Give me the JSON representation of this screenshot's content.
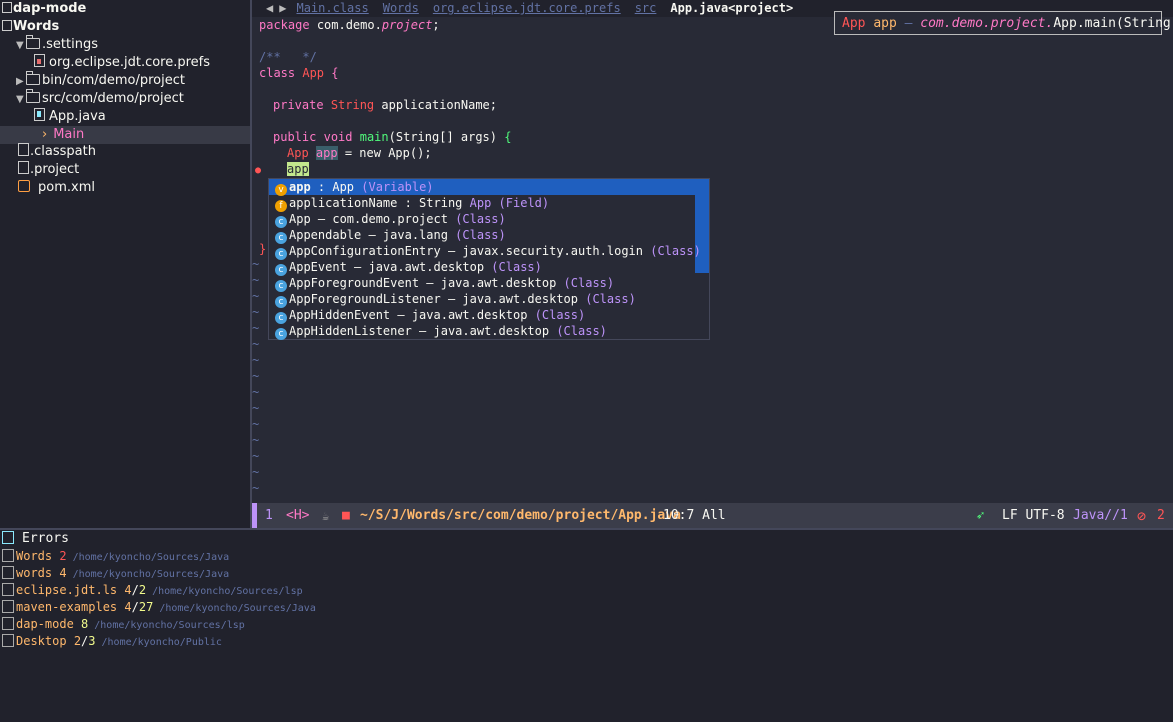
{
  "sidebar": {
    "workspace": "dap-mode",
    "project": "Words",
    "items": [
      {
        "label": ".settings"
      },
      {
        "label": "org.eclipse.jdt.core.prefs"
      },
      {
        "label": "bin/com/demo/project"
      },
      {
        "label": "src/com/demo/project"
      },
      {
        "label": "App.java"
      },
      {
        "label": "Main"
      },
      {
        "label": ".classpath"
      },
      {
        "label": ".project"
      },
      {
        "label": "pom.xml"
      }
    ]
  },
  "header": {
    "nav_back": "◀",
    "nav_forward": "▶",
    "crumbs": [
      "Main.class",
      "Words",
      "org.eclipse.jdt.core.prefs",
      "src"
    ],
    "current": "App.java<project>"
  },
  "code": {
    "line1": {
      "kw": "package",
      "rest": "com.demo.",
      "pkg": "project",
      "end": ";"
    },
    "line2": "/**   */",
    "line3": {
      "kw": "class",
      "name": "App",
      "brace": "{"
    },
    "line4": {
      "kw": "private",
      "type": "String",
      "field": "applicationName;"
    },
    "line5": {
      "kw": "public",
      "ret": "void",
      "fn": "main",
      "args": "(String[] args)",
      "brace": "{"
    },
    "line6": {
      "type": "App",
      "var": "app",
      "eq": "= new App();"
    },
    "line7": "app",
    "closing_brace": "}"
  },
  "signature": {
    "type": "App",
    "var": "app",
    "sep": "–",
    "pkg": "com.demo.project.",
    "method": "App.main(String[])"
  },
  "completions": [
    {
      "icon": "v",
      "name": "app",
      "detail": " : App",
      "kind": "(Variable)"
    },
    {
      "icon": "f",
      "name": "applicationName",
      "detail": " : String ",
      "extra": "App",
      "kind": "(Field)"
    },
    {
      "icon": "c",
      "name": "App",
      "detail": " – com.demo.project ",
      "kind": "(Class)"
    },
    {
      "icon": "c",
      "name": "Appendable",
      "detail": " – java.lang ",
      "kind": "(Class)"
    },
    {
      "icon": "c",
      "name": "AppConfigurationEntry",
      "detail": " – javax.security.auth.login ",
      "kind": "(Class)"
    },
    {
      "icon": "c",
      "name": "AppEvent",
      "detail": " – java.awt.desktop ",
      "kind": "(Class)"
    },
    {
      "icon": "c",
      "name": "AppForegroundEvent",
      "detail": " – java.awt.desktop ",
      "kind": "(Class)"
    },
    {
      "icon": "c",
      "name": "AppForegroundListener",
      "detail": " – java.awt.desktop ",
      "kind": "(Class)"
    },
    {
      "icon": "c",
      "name": "AppHiddenEvent",
      "detail": " – java.awt.desktop ",
      "kind": "(Class)"
    },
    {
      "icon": "c",
      "name": "AppHiddenListener",
      "detail": " – java.awt.desktop ",
      "kind": "(Class)"
    }
  ],
  "modeline": {
    "window_num": "1",
    "evil_state": "<H>",
    "path": "~/S/J/Words/src/com/demo/project/App.java",
    "position": "10:7 All",
    "eol_encoding": "LF UTF-8",
    "mode": "Java//1",
    "error_count": "2"
  },
  "errors_panel": {
    "title": "Errors",
    "projects": [
      {
        "name": "Words",
        "count_a": "2",
        "count_b": "",
        "path": "/home/kyoncho/Sources/Java"
      },
      {
        "name": "words",
        "count_a": "4",
        "count_b": "",
        "path": "/home/kyoncho/Sources/Java"
      },
      {
        "name": "eclipse.jdt.ls",
        "count_a": "4",
        "count_b": "2",
        "path": "/home/kyoncho/Sources/lsp"
      },
      {
        "name": "maven-examples",
        "count_a": "4",
        "count_b": "27",
        "path": "/home/kyoncho/Sources/Java"
      },
      {
        "name": "dap-mode",
        "count_a": "8",
        "count_b": "",
        "path": "/home/kyoncho/Sources/lsp"
      },
      {
        "name": "Desktop",
        "count_a": "2",
        "count_b": "3",
        "path": "/home/kyoncho/Public"
      }
    ]
  },
  "colors": {
    "background": "#282a36",
    "sidebar": "#21222c",
    "selection": "#1f5fbf",
    "accent_purple": "#bd93f9",
    "orange": "#ffb86c",
    "error_red": "#ff5555"
  }
}
